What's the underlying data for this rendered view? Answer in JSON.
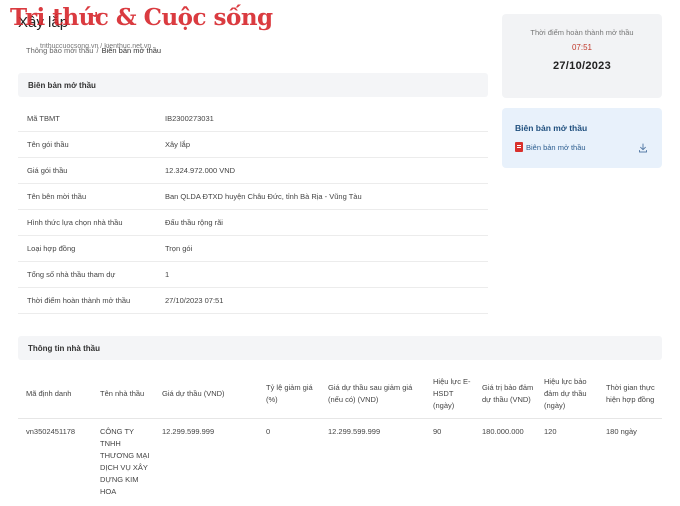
{
  "watermark": {
    "logo_text": "Tri thức & Cuộc sống",
    "sub_text": "trithuccuocsong.vn / kienthuc.net.vn"
  },
  "page_title": "Xây lắp",
  "breadcrumb": [
    "Thông báo mời thầu",
    "Biên bản mở thầu"
  ],
  "time_card": {
    "label": "Thời điểm hoàn thành mở thầu",
    "time": "07:51",
    "date": "27/10/2023"
  },
  "doc_card": {
    "title": "Biên bản mở thầu",
    "link_label": "Biên bản mở thầu",
    "icon": "pdf-icon",
    "action_icon": "download-icon"
  },
  "section_main": {
    "title": "Biên bản mở thầu"
  },
  "info_rows": [
    {
      "label": "Mã TBMT",
      "value": "IB2300273031"
    },
    {
      "label": "Tên gói thầu",
      "value": "Xây lắp"
    },
    {
      "label": "Giá gói thầu",
      "value": "12.324.972.000 VND"
    },
    {
      "label": "Tên bên mời thầu",
      "value": "Ban QLDA ĐTXD huyện Châu Đức, tỉnh Bà Rịa - Vũng Tàu"
    },
    {
      "label": "Hình thức lựa chọn nhà thầu",
      "value": "Đấu thầu rộng rãi"
    },
    {
      "label": "Loại hợp đồng",
      "value": "Trọn gói"
    },
    {
      "label": "Tổng số nhà thầu tham dự",
      "value": "1"
    },
    {
      "label": "Thời điểm hoàn thành mở thầu",
      "value": "27/10/2023 07:51"
    }
  ],
  "section_contractor": {
    "title": "Thông tin nhà thầu"
  },
  "bid_table": {
    "headers": [
      "Mã định danh",
      "Tên nhà thầu",
      "Giá dự thầu (VND)",
      "Tỷ lệ giảm giá (%)",
      "Giá dự thầu sau giảm giá (nếu có) (VND)",
      "Hiệu lực E-HSDT (ngày)",
      "Giá trị bảo đảm dự thầu (VND)",
      "Hiệu lực bảo đảm dự thầu (ngày)",
      "Thời gian thực hiện hợp đồng"
    ],
    "rows": [
      {
        "id": "vn3502451178",
        "name": "CÔNG TY TNHH THƯƠNG MẠI DỊCH VỤ XÂY DỰNG KIM HOA",
        "bid_price": "12.299.599.999",
        "discount": "0",
        "price_after_discount": "12.299.599.999",
        "validity": "90",
        "guarantee_value": "180.000.000",
        "guarantee_validity": "120",
        "duration": "180 ngày"
      }
    ]
  },
  "colors": {
    "brand_red": "#d7262c",
    "time_red": "#c0392b",
    "doc_blue": "#1f4f7e"
  }
}
